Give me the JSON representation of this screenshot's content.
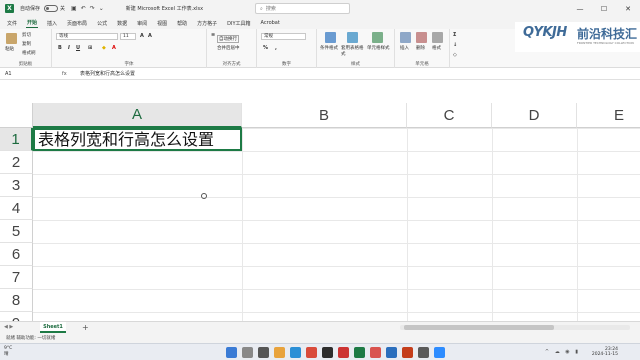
{
  "titlebar": {
    "autosave_label": "自动保存",
    "autosave_state": "关",
    "doc_title": "新建 Microsoft Excel 工作表.xlsx",
    "search_placeholder": "搜索",
    "icons": [
      "excel-icon",
      "save-icon",
      "undo-icon",
      "redo-icon",
      "more-icon"
    ]
  },
  "menu": {
    "tabs": [
      "文件",
      "开始",
      "插入",
      "页面布局",
      "公式",
      "数据",
      "审阅",
      "视图",
      "帮助",
      "方方格子",
      "DIY工具箱",
      "Acrobat"
    ],
    "active": "开始"
  },
  "ribbon": {
    "clipboard": {
      "paste": "粘贴",
      "cut": "剪切",
      "copy": "复制",
      "format_painter": "格式刷",
      "label": "剪贴板"
    },
    "font": {
      "name": "等线",
      "size": "11",
      "label": "字体"
    },
    "alignment": {
      "wrap": "自动换行",
      "merge": "合并后居中",
      "label": "对齐方式"
    },
    "number": {
      "format": "常规",
      "label": "数字"
    },
    "styles": {
      "conditional": "条件格式",
      "table": "套用表格格式",
      "cell_styles": "单元格样式",
      "label": "样式"
    },
    "cells": {
      "insert": "插入",
      "delete": "删除",
      "format": "格式",
      "label": "单元格"
    }
  },
  "logo": {
    "brand": "QYKJH",
    "cn": "前沿科技汇",
    "sub": "FRONTIER TECHNOLOGY COLLECTION"
  },
  "formula_bar": {
    "name_box": "A1",
    "fx": "fx",
    "content": "表格列宽和行高怎么设置"
  },
  "grid": {
    "columns": [
      "A",
      "B",
      "C",
      "D",
      "E"
    ],
    "rows": [
      "1",
      "2",
      "3",
      "4",
      "5",
      "6",
      "7",
      "8",
      "9"
    ],
    "A1": "表格列宽和行高怎么设置"
  },
  "sheets": {
    "tabs": [
      "Sheet1"
    ],
    "add": "+"
  },
  "status": {
    "text": "就绪   辅助功能: 一切就绪"
  },
  "taskbar": {
    "temp": "9°C",
    "weather": "晴",
    "time": "23:24",
    "date": "2024-11-15"
  }
}
